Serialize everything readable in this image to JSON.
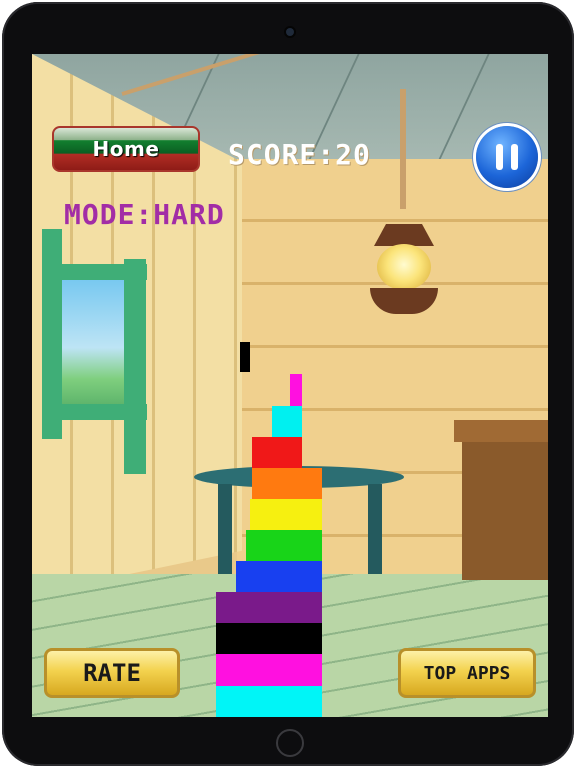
{
  "hud": {
    "home_label": "Home",
    "score_text": "SCORE:20",
    "mode_text": "MODE:HARD",
    "rate_label": "RATE",
    "top_apps_label": "TOP APPS"
  },
  "colors": {
    "mode_text": "#a22da6",
    "pause_button": "#1c65d8",
    "gold_button": "#f3d24e",
    "home_button_green": "#127f2f",
    "home_button_red": "#b22d24"
  },
  "tower": {
    "falling_block_color": "#000000",
    "blocks": [
      {
        "color": "#00f5f7"
      },
      {
        "color": "#ff10e0"
      },
      {
        "color": "#000000"
      },
      {
        "color": "#7a1a8a"
      },
      {
        "color": "#1840f0"
      },
      {
        "color": "#18d418"
      },
      {
        "color": "#f6f010"
      },
      {
        "color": "#ff7a10"
      },
      {
        "color": "#f01818"
      },
      {
        "color": "#00f0f0"
      },
      {
        "color": "#ff10e0"
      }
    ]
  }
}
